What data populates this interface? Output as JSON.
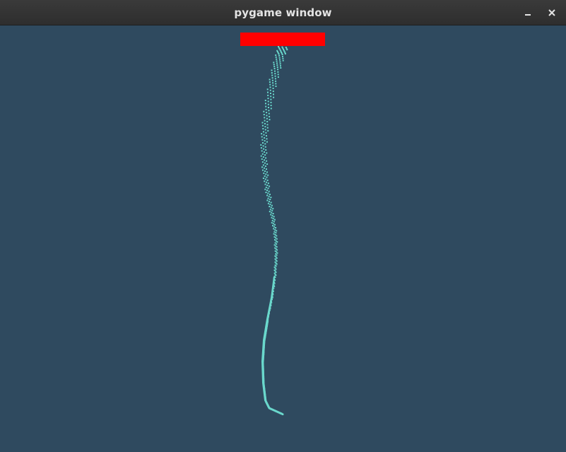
{
  "window": {
    "title": "pygame window",
    "minimize_icon": "minimize-icon",
    "close_icon": "close-icon"
  },
  "game": {
    "background_color": "#2f4a5f",
    "paddle_color": "#ff0000",
    "trail_color": "#6ad8cc"
  }
}
